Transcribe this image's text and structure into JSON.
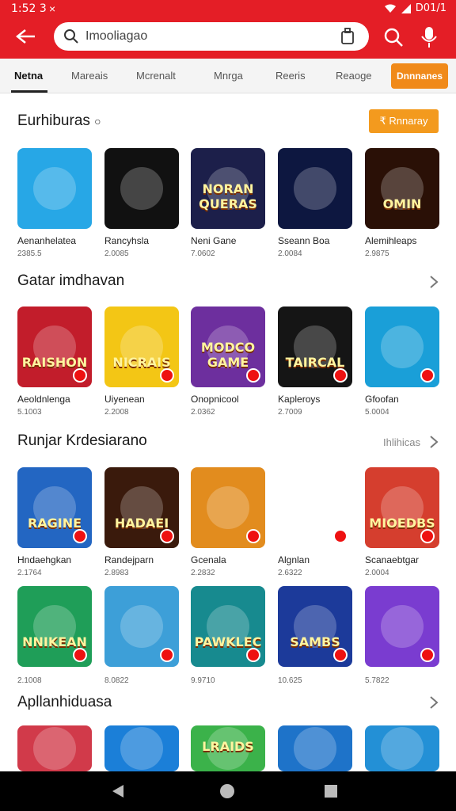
{
  "status": {
    "time": "1:52 3",
    "x_icon": "×",
    "right_text": "D01/1"
  },
  "search": {
    "text": "Imooliagao"
  },
  "tabs": {
    "items": [
      "Netna",
      "Mareais",
      "Mcrenalt",
      "Mnrga",
      "Reeris",
      "Reaoge"
    ],
    "cta": "Dnnnanes"
  },
  "sections": [
    {
      "title": "Eurhiburas",
      "title_suffix": "○",
      "pill": "₹ Rnnaray",
      "cards": [
        {
          "name": "Aenanhelatea",
          "meta": "2385.5",
          "word": "",
          "bg": "#27a7e6"
        },
        {
          "name": "Rancyhsla",
          "meta": "2.0085",
          "word": "",
          "bg": "#111111"
        },
        {
          "name": "Neni Gane",
          "meta": "7.0602",
          "word": "NORAN QUERAS",
          "bg": "#1c1f4a"
        },
        {
          "name": "Sseann Boa",
          "meta": "2.0084",
          "word": "",
          "bg": "#0d1740"
        },
        {
          "name": "Alemihleaps",
          "meta": "2.9875",
          "word": "OMIN",
          "bg": "#2a1006"
        }
      ]
    },
    {
      "title": "Gatar imdhavan",
      "cards": [
        {
          "name": "Aeoldnlenga",
          "meta": "5.1003",
          "word": "RAISHON",
          "bg": "#c21d2b"
        },
        {
          "name": "Uiyenean",
          "meta": "2.2008",
          "word": "NICRAIS",
          "bg": "#f3c615"
        },
        {
          "name": "Onopnicool",
          "meta": "2.0362",
          "word": "MODCO GAME",
          "bg": "#6d2f9e"
        },
        {
          "name": "Kapleroys",
          "meta": "2.7009",
          "word": "TAIRCAL",
          "bg": "#151515"
        },
        {
          "name": "Gfoofan",
          "meta": "5.0004",
          "word": "",
          "bg": "#1a9fd8"
        }
      ]
    },
    {
      "title": "Runjar Krdesiarano",
      "more": "Ihlihicas",
      "cards": [
        {
          "name": "Hndaehgkan",
          "meta": "2.1764",
          "word": "RAGINE",
          "bg": "#2366c2"
        },
        {
          "name": "Randejparn",
          "meta": "2.8983",
          "word": "HADAEI",
          "bg": "#3a1a0c"
        },
        {
          "name": "Gcenala",
          "meta": "2.2832",
          "word": "",
          "bg": "#e28c1e"
        },
        {
          "name": "Algnlan",
          "meta": "2.6322",
          "word": "",
          "bg": "#ffffff"
        },
        {
          "name": "Scanaebtgar",
          "meta": "2.0004",
          "word": "MIOEDBS",
          "bg": "#d53e2e"
        },
        {
          "name": "",
          "meta": "2.1008",
          "word": "NNIKEAN",
          "bg": "#1f9e58"
        },
        {
          "name": "",
          "meta": "8.0822",
          "word": "",
          "bg": "#3d9fd8"
        },
        {
          "name": "",
          "meta": "9.9710",
          "word": "PAWKLEC",
          "bg": "#178a8f"
        },
        {
          "name": "",
          "meta": "10.625",
          "word": "SAMBS",
          "bg": "#1c3a9a"
        },
        {
          "name": "",
          "meta": "5.7822",
          "word": "",
          "bg": "#7a3cd0"
        }
      ]
    },
    {
      "title": "Apllanhiduasa",
      "cards": [
        {
          "word": "",
          "bg": "#d13a4a"
        },
        {
          "word": "",
          "bg": "#1b7fd8"
        },
        {
          "word": "LRAIDS",
          "bg": "#3bb24a"
        },
        {
          "word": "",
          "bg": "#1e73c9"
        },
        {
          "word": "",
          "bg": "#2390d6"
        }
      ]
    }
  ]
}
